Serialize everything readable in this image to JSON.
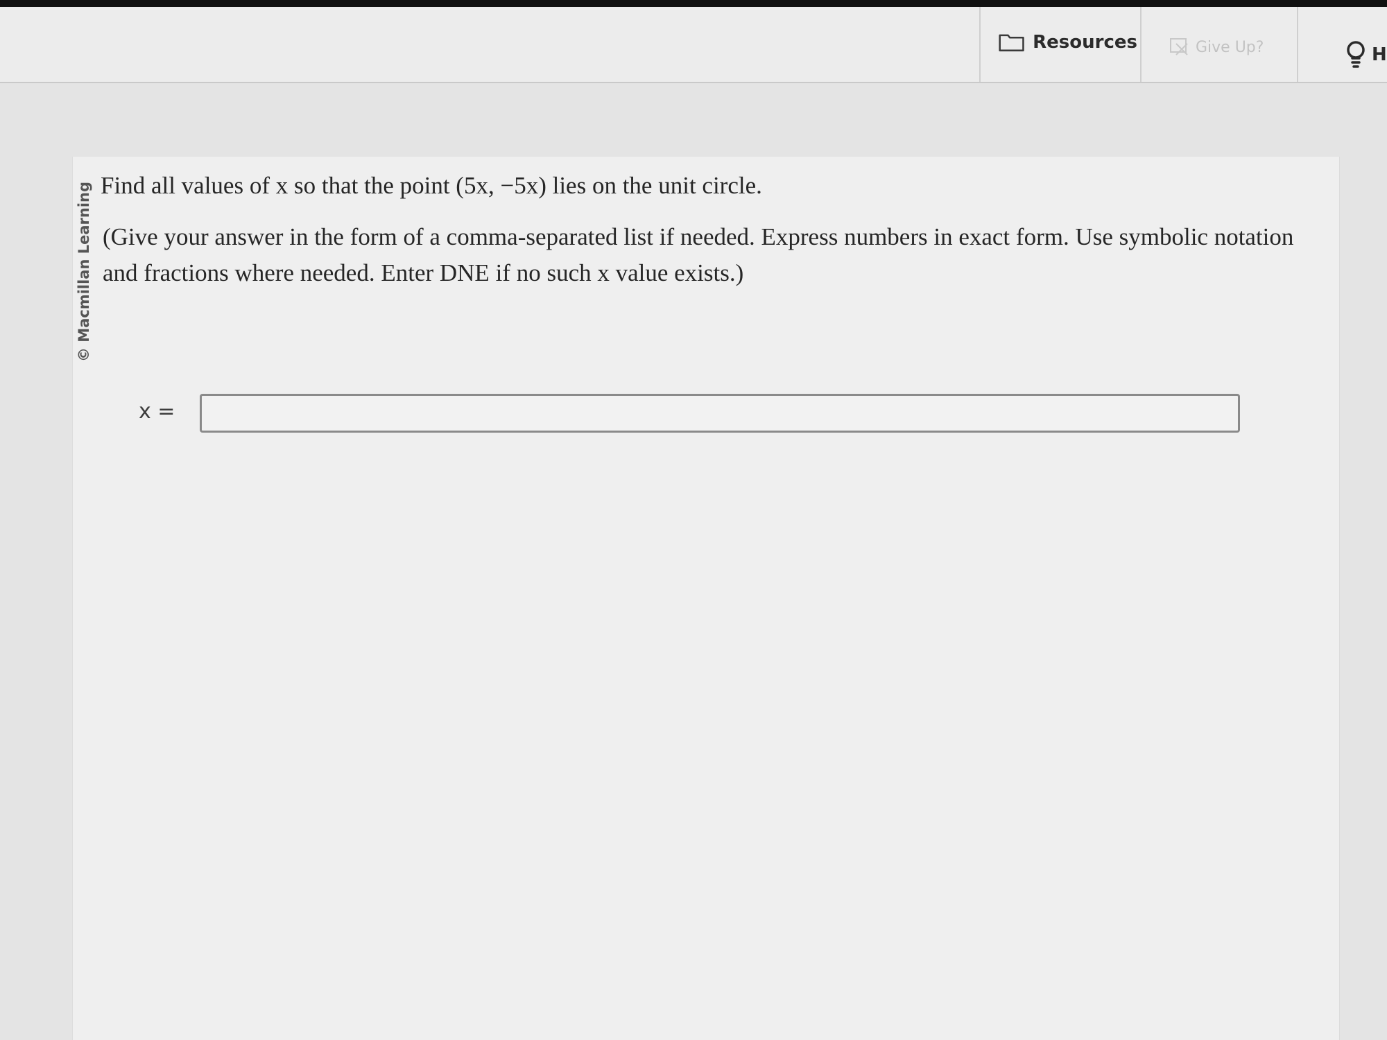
{
  "toolbar": {
    "resources_label": "Resources",
    "give_up_label": "Give Up?",
    "hint_label": "H"
  },
  "question": {
    "copyright": "© Macmillan Learning",
    "main_text": "Find all values of x so that the point (5x, −5x) lies on the unit circle.",
    "instructions": "(Give your answer in the form of a comma-separated list if needed. Express numbers in exact form. Use symbolic notation and fractions where needed. Enter DNE if no such x value exists.)",
    "answer_label": "x =",
    "answer_value": ""
  },
  "icons": {
    "resources": "folder-icon",
    "give_up": "give-up-icon",
    "hint": "lightbulb-icon"
  }
}
